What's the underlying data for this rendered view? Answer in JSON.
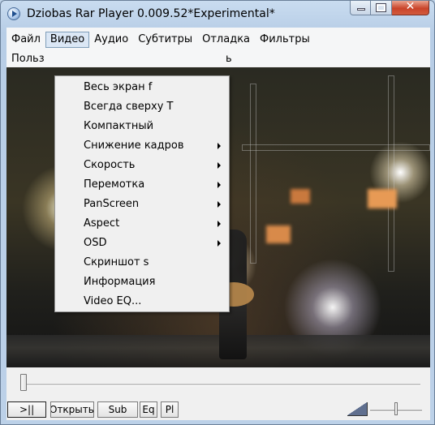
{
  "window": {
    "title": "Dziobas Rar Player 0.009.52*Experimental*",
    "app_icon": "play-circle-icon",
    "buttons": {
      "minimize": "minimize",
      "maximize": "maximize",
      "close": "✕"
    }
  },
  "menubar": {
    "row1": [
      "Файл",
      "Видео",
      "Аудио",
      "Субтитры",
      "Отладка",
      "Фильтры"
    ],
    "row2_visible_fragments": [
      "Польз",
      "ь"
    ],
    "active_menu": "Видео"
  },
  "video_menu": {
    "items": [
      {
        "label": "Весь экран f",
        "submenu": false
      },
      {
        "label": "Всегда сверху T",
        "submenu": false
      },
      {
        "label": "Компактный",
        "submenu": false
      },
      {
        "label": "Снижение кадров",
        "submenu": true
      },
      {
        "label": "Скорость",
        "submenu": true
      },
      {
        "label": "Перемотка",
        "submenu": true
      },
      {
        "label": "PanScreen",
        "submenu": true
      },
      {
        "label": "Aspect",
        "submenu": true
      },
      {
        "label": "OSD",
        "submenu": true
      },
      {
        "label": "Скриншот s",
        "submenu": false
      },
      {
        "label": "Информация",
        "submenu": false
      },
      {
        "label": "Video EQ...",
        "submenu": false
      }
    ]
  },
  "seek": {
    "position_fraction": 0.0
  },
  "controls": {
    "play_pause_label": ">||",
    "open_label": "Открыть",
    "sub_label": "Sub",
    "eq_label": "Eq",
    "pl_label": "Pl"
  },
  "volume": {
    "icon": "volume-icon",
    "level_fraction": 0.5
  }
}
